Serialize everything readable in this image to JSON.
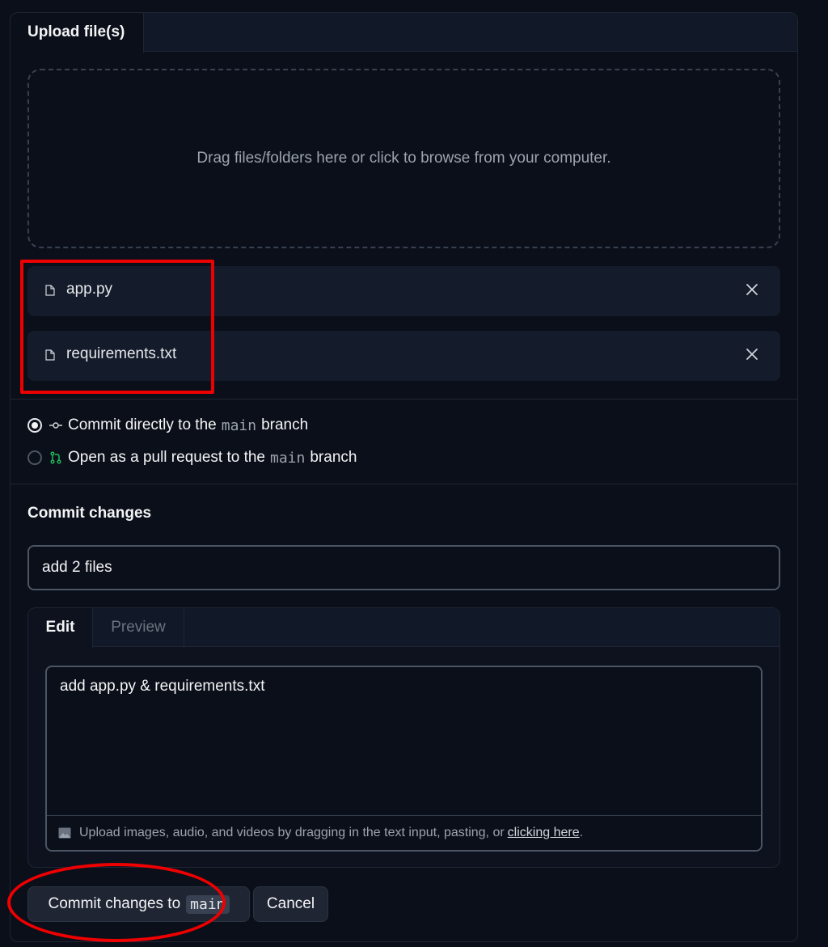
{
  "upload_tab": {
    "label": "Upload file(s)"
  },
  "dropzone": {
    "text": "Drag files/folders here or click to browse from your computer."
  },
  "files": [
    {
      "name": "app.py"
    },
    {
      "name": "requirements.txt"
    }
  ],
  "commit_options": {
    "direct": {
      "prefix": "Commit directly to the",
      "branch": "main",
      "suffix": "branch",
      "selected": true
    },
    "pull_request": {
      "prefix": "Open as a pull request to the",
      "branch": "main",
      "suffix": "branch",
      "selected": false
    }
  },
  "commit": {
    "section_title": "Commit changes",
    "summary_value": "add 2 files",
    "editor": {
      "tab_edit": "Edit",
      "tab_preview": "Preview",
      "description_value": "add app.py & requirements.txt",
      "upload_hint_text": "Upload images, audio, and videos by dragging in the text input, pasting, or",
      "upload_hint_link": "clicking here",
      "upload_hint_end": "."
    }
  },
  "buttons": {
    "commit_label": "Commit changes to",
    "commit_branch": "main",
    "cancel_label": "Cancel"
  },
  "colors": {
    "background": "#0b0f19",
    "highlight": "#ee0000",
    "pr_icon": "#22c55e"
  }
}
